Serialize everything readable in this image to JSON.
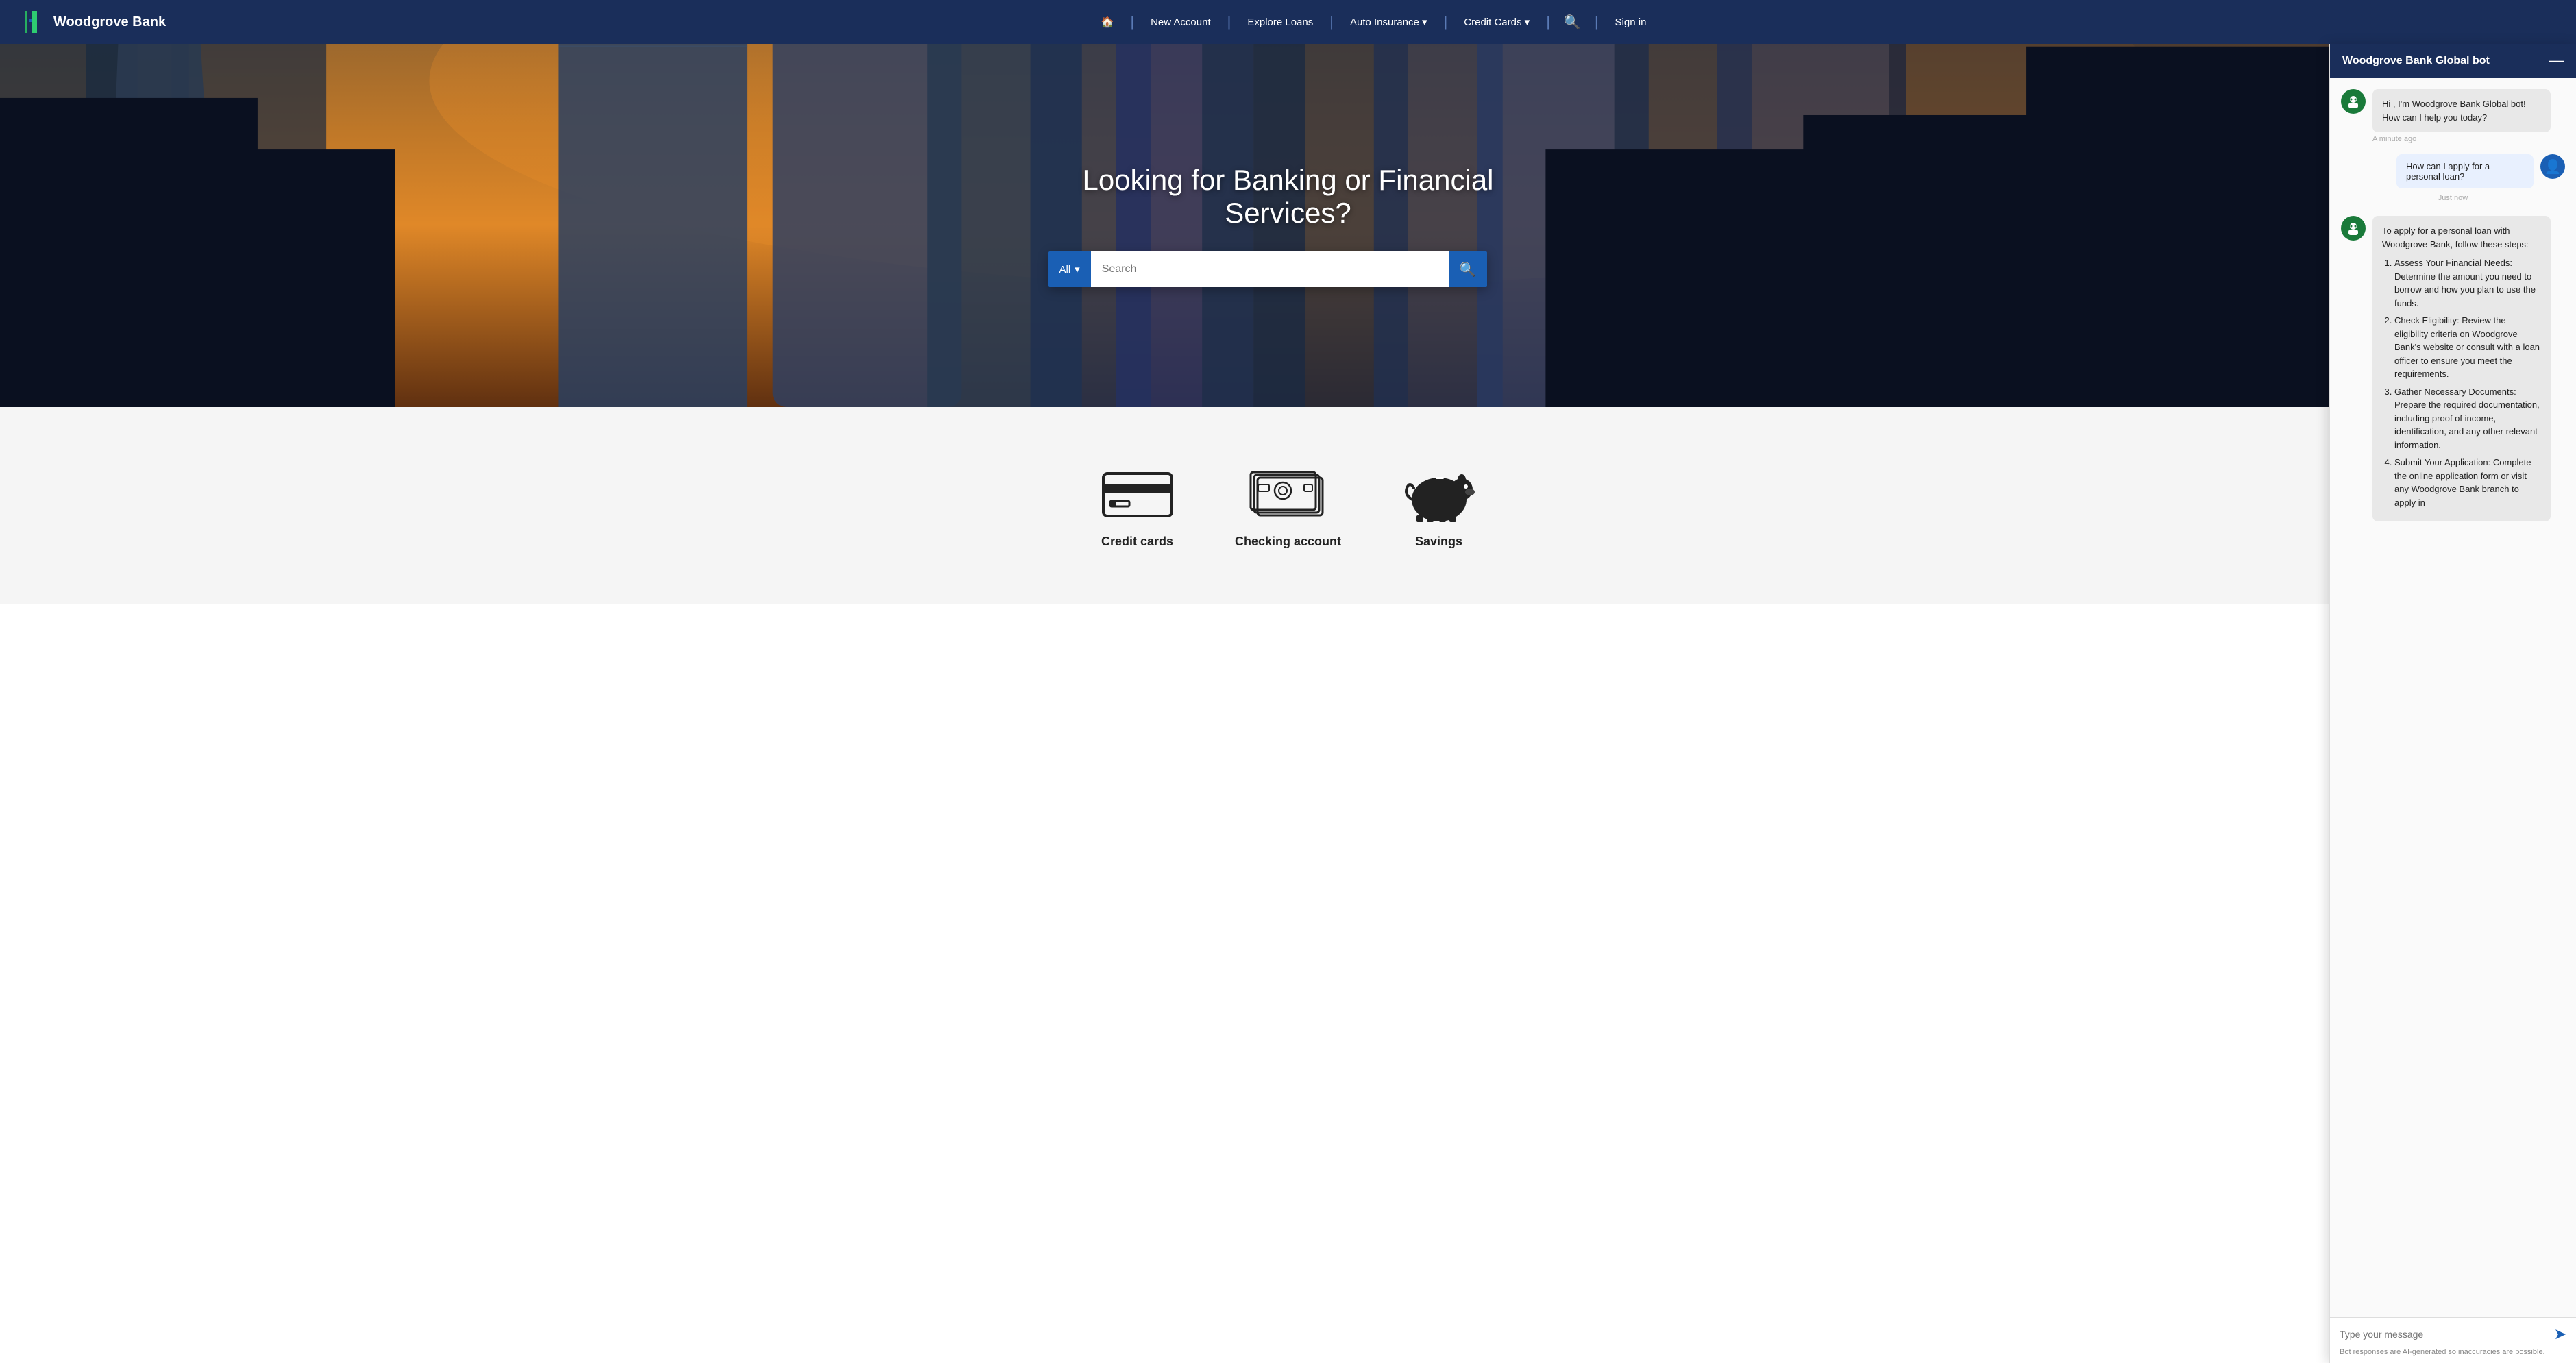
{
  "navbar": {
    "brand": "Woodgrove Bank",
    "home_label": "🏠",
    "links": [
      {
        "label": "New Account",
        "id": "new-account"
      },
      {
        "label": "Explore Loans",
        "id": "explore-loans"
      },
      {
        "label": "Auto Insurance",
        "id": "auto-insurance",
        "dropdown": true
      },
      {
        "label": "Credit Cards",
        "id": "credit-cards",
        "dropdown": true
      }
    ],
    "search_label": "🔍",
    "signin_label": "Sign in"
  },
  "hero": {
    "title": "Looking for Banking or Financial Services?",
    "search_placeholder": "Search",
    "search_dropdown_label": "All"
  },
  "services": [
    {
      "id": "credit-cards-card",
      "label": "Credit cards",
      "icon": "credit-card"
    },
    {
      "id": "checking-account-card",
      "label": "Checking account",
      "icon": "cash"
    },
    {
      "id": "savings-card",
      "label": "Savings",
      "icon": "piggy-bank"
    }
  ],
  "chat": {
    "title": "Woodgrove Bank Global bot",
    "minimize_label": "—",
    "messages": [
      {
        "type": "bot",
        "text": "Hi , I'm Woodgrove Bank Global bot! How can I help you today?",
        "timestamp": "A minute ago"
      },
      {
        "type": "user",
        "text": "How can I apply for a personal loan?",
        "timestamp": "Just now"
      },
      {
        "type": "bot",
        "text": "To apply for a personal loan with Woodgrove Bank, follow these steps:",
        "steps": [
          "Assess Your Financial Needs: Determine the amount you need to borrow and how you plan to use the funds.",
          "Check Eligibility: Review the eligibility criteria on Woodgrove Bank's website or consult with a loan officer to ensure you meet the requirements.",
          "Gather Necessary Documents: Prepare the required documentation, including proof of income, identification, and any other relevant information.",
          "Submit Your Application: Complete the online application form or visit any Woodgrove Bank branch to apply in"
        ]
      }
    ],
    "input_placeholder": "Type your message",
    "send_label": "➤",
    "disclaimer": "Bot responses are AI-generated so inaccuracies are possible."
  }
}
